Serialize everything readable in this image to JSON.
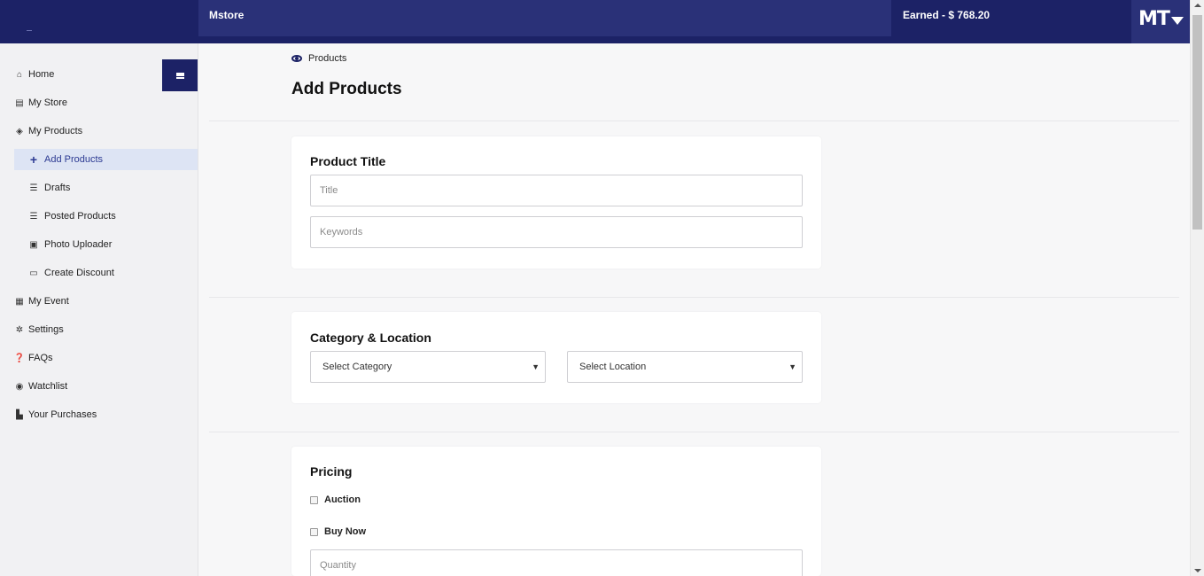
{
  "header": {
    "app_title": "Mstore",
    "earned": "Earned - $ 768.20",
    "user_initials": "MT"
  },
  "sidebar": {
    "items": [
      {
        "label": "Home",
        "icon": "home-icon"
      },
      {
        "label": "My Store",
        "icon": "store-icon"
      },
      {
        "label": "My Products",
        "icon": "layers-icon"
      },
      {
        "label": "Add Products",
        "icon": "plus-icon"
      },
      {
        "label": "Drafts",
        "icon": "list-icon"
      },
      {
        "label": "Posted Products",
        "icon": "list-icon"
      },
      {
        "label": "Photo Uploader",
        "icon": "images-icon"
      },
      {
        "label": "Create Discount",
        "icon": "money-icon"
      },
      {
        "label": "My Event",
        "icon": "calendar-icon"
      },
      {
        "label": "Settings",
        "icon": "gear-icon"
      },
      {
        "label": "FAQs",
        "icon": "question-icon"
      },
      {
        "label": "Watchlist",
        "icon": "eye-icon"
      },
      {
        "label": "Your Purchases",
        "icon": "bag-icon"
      }
    ],
    "active_item": "Add Products"
  },
  "breadcrumb": {
    "label": "Products"
  },
  "page": {
    "title": "Add Products"
  },
  "product_title_card": {
    "heading": "Product Title",
    "title_placeholder": "Title",
    "keywords_placeholder": "Keywords"
  },
  "category_card": {
    "heading": "Category & Location",
    "category_selected": "Select Category",
    "location_selected": "Select Location"
  },
  "pricing_card": {
    "heading": "Pricing",
    "auction_label": "Auction",
    "buy_now_label": "Buy Now",
    "quantity_placeholder": "Quantity"
  },
  "colors": {
    "brand_navy": "#1c2266",
    "active_bg": "#dde4f4",
    "active_text": "#2c3a92"
  }
}
